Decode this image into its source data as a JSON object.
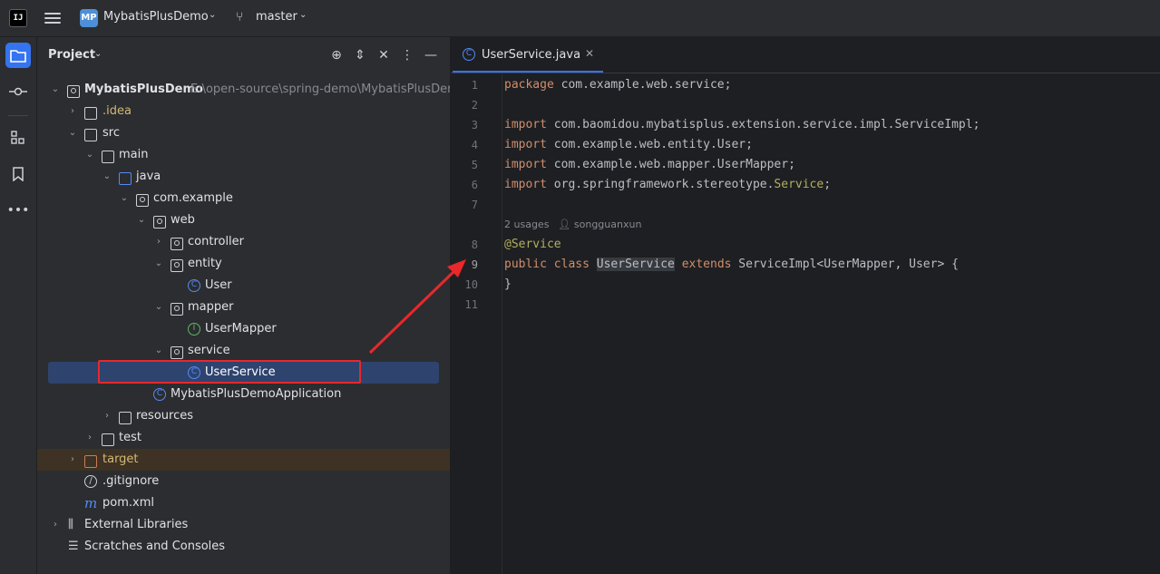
{
  "titlebar": {
    "logo": "IJ",
    "project_badge": "MP",
    "project_name": "MybatisPlusDemo",
    "branch": "master"
  },
  "project_panel": {
    "title": "Project",
    "tree": [
      {
        "label": "MybatisPlusDemo",
        "path": "E:\\open-source\\spring-demo\\MybatisPlusDemo"
      },
      {
        "label": ".idea"
      },
      {
        "label": "src"
      },
      {
        "label": "main"
      },
      {
        "label": "java"
      },
      {
        "label": "com.example"
      },
      {
        "label": "web"
      },
      {
        "label": "controller"
      },
      {
        "label": "entity"
      },
      {
        "label": "User"
      },
      {
        "label": "mapper"
      },
      {
        "label": "UserMapper"
      },
      {
        "label": "service"
      },
      {
        "label": "UserService"
      },
      {
        "label": "MybatisPlusDemoApplication"
      },
      {
        "label": "resources"
      },
      {
        "label": "test"
      },
      {
        "label": "target"
      },
      {
        "label": ".gitignore"
      },
      {
        "label": "pom.xml"
      },
      {
        "label": "External Libraries"
      },
      {
        "label": "Scratches and Consoles"
      }
    ]
  },
  "editor": {
    "tab_label": "UserService.java",
    "line_numbers": [
      "1",
      "2",
      "3",
      "4",
      "5",
      "6",
      "7",
      "8",
      "9",
      "10",
      "11"
    ],
    "usages_hint": "2 usages",
    "author_hint": "songguanxun",
    "code": {
      "l1_kw": "package",
      "l1_rest": " com.example.web.service;",
      "l3_kw": "import",
      "l3_rest": " com.baomidou.mybatisplus.extension.service.impl.ServiceImpl;",
      "l4_kw": "import",
      "l4_rest": " com.example.web.entity.User;",
      "l5_kw": "import",
      "l5_rest": " com.example.web.mapper.UserMapper;",
      "l6_kw": "import",
      "l6_rest": " org.springframework.stereotype.",
      "l6_ann": "Service",
      "l6_end": ";",
      "l8_ann": "@Service",
      "l9_kw1": "public",
      "l9_kw2": "class",
      "l9_name": "UserService",
      "l9_kw3": "extends",
      "l9_rest": " ServiceImpl<UserMapper, User> {",
      "l10": "}"
    }
  },
  "colors": {
    "accent": "#3574f0",
    "annotation_red": "#e8282b"
  }
}
